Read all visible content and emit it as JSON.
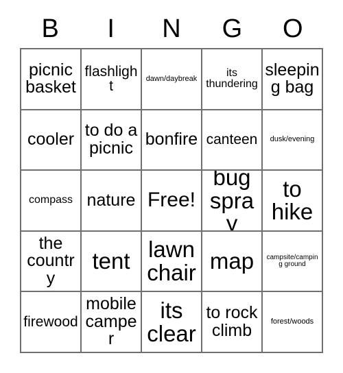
{
  "card": {
    "header_letters": [
      "B",
      "I",
      "N",
      "G",
      "O"
    ],
    "rows": [
      [
        {
          "text": "picnic basket",
          "size": "fs-md"
        },
        {
          "text": "flashlight",
          "size": "fs-sm"
        },
        {
          "text": "dawn/daybreak",
          "size": "fs-xxs"
        },
        {
          "text": "its thundering",
          "size": "fs-xs"
        },
        {
          "text": "sleeping bag",
          "size": "fs-md"
        }
      ],
      [
        {
          "text": "cooler",
          "size": "fs-md"
        },
        {
          "text": "to do a picnic",
          "size": "fs-md"
        },
        {
          "text": "bonfire",
          "size": "fs-md"
        },
        {
          "text": "canteen",
          "size": "fs-sm"
        },
        {
          "text": "dusk/evening",
          "size": "fs-xxs"
        }
      ],
      [
        {
          "text": "compass",
          "size": "fs-xs"
        },
        {
          "text": "nature",
          "size": "fs-md"
        },
        {
          "text": "Free!",
          "size": "fs-lg"
        },
        {
          "text": "bug spray",
          "size": "fs-xl"
        },
        {
          "text": "to hike",
          "size": "fs-xl"
        }
      ],
      [
        {
          "text": "the country",
          "size": "fs-md"
        },
        {
          "text": "tent",
          "size": "fs-xl"
        },
        {
          "text": "lawn chair",
          "size": "fs-xl"
        },
        {
          "text": "map",
          "size": "fs-xl"
        },
        {
          "text": "campsite/camping ground",
          "size": "fs-tiny"
        }
      ],
      [
        {
          "text": "firewood",
          "size": "fs-sm"
        },
        {
          "text": "mobile camper",
          "size": "fs-md"
        },
        {
          "text": "its clear",
          "size": "fs-xl"
        },
        {
          "text": "to rock climb",
          "size": "fs-md"
        },
        {
          "text": "forest/woods",
          "size": "fs-xxs"
        }
      ]
    ]
  }
}
